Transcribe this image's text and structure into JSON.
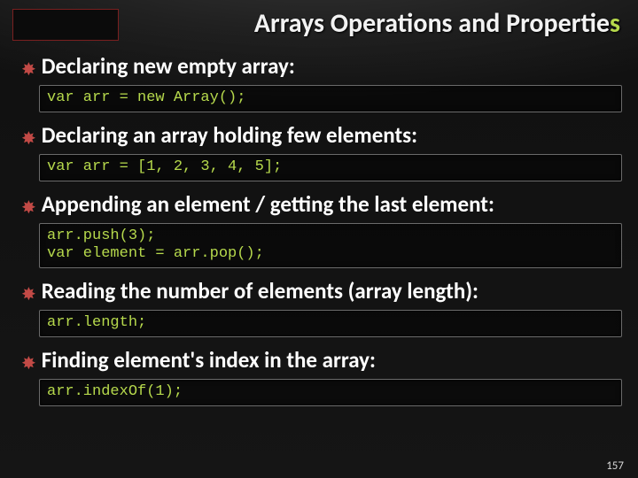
{
  "title_prefix": "Arrays Operations and Propertie",
  "title_accent": "s",
  "bullets": [
    {
      "text": "Declaring new empty array:",
      "code": "var arr = new Array();"
    },
    {
      "text": "Declaring an array holding few elements:",
      "code": "var arr = [1, 2, 3, 4, 5];"
    },
    {
      "text": "Appending an element / getting the last element:",
      "code": "arr.push(3);\nvar element = arr.pop();"
    },
    {
      "text": "Reading the number of elements (array length):",
      "code": "arr.length;"
    },
    {
      "text": "Finding element's index in the array:",
      "code": "arr.indexOf(1);"
    }
  ],
  "page_number": "157"
}
